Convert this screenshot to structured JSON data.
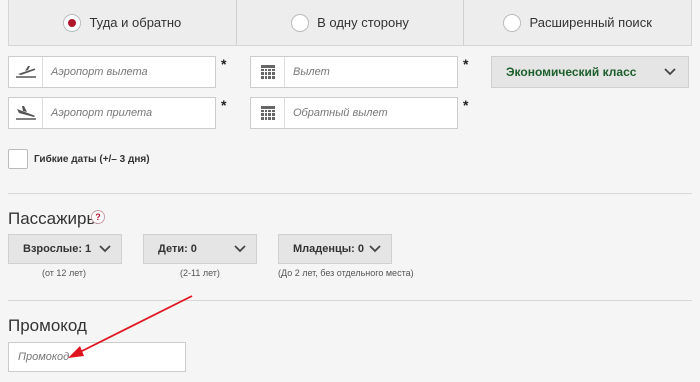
{
  "trip_type": {
    "options": [
      {
        "label": "Туда и обратно",
        "selected": true
      },
      {
        "label": "В одну сторону",
        "selected": false
      },
      {
        "label": "Расширенный поиск",
        "selected": false
      }
    ]
  },
  "search": {
    "departure_airport_placeholder": "Аэропорт вылета",
    "arrival_airport_placeholder": "Аэропорт прилета",
    "departure_date_placeholder": "Вылет",
    "return_date_placeholder": "Обратный вылет",
    "required_mark": "*",
    "cabin_class": "Экономический класс"
  },
  "flexible_dates": {
    "label": "Гибкие даты (+/– 3 дня)",
    "checked": false
  },
  "passengers": {
    "title": "Пассажиры",
    "help": "?",
    "adults": {
      "label": "Взрослые: 1",
      "note": "(от 12 лет)"
    },
    "children": {
      "label": "Дети: 0",
      "note": "(2-11 лет)"
    },
    "infants": {
      "label": "Младенцы: 0",
      "note": "(До 2 лет, без отдельного места)"
    }
  },
  "promo": {
    "title": "Промокод",
    "placeholder": "Промокод"
  },
  "colors": {
    "accent": "#b0152a",
    "class_text": "#1d5f2b",
    "annotation_arrow": "#e0141e"
  },
  "icons": [
    "departure-plane-icon",
    "arrival-plane-icon",
    "calendar-icon",
    "chevron-down-icon",
    "radio-selected-icon",
    "help-icon"
  ]
}
